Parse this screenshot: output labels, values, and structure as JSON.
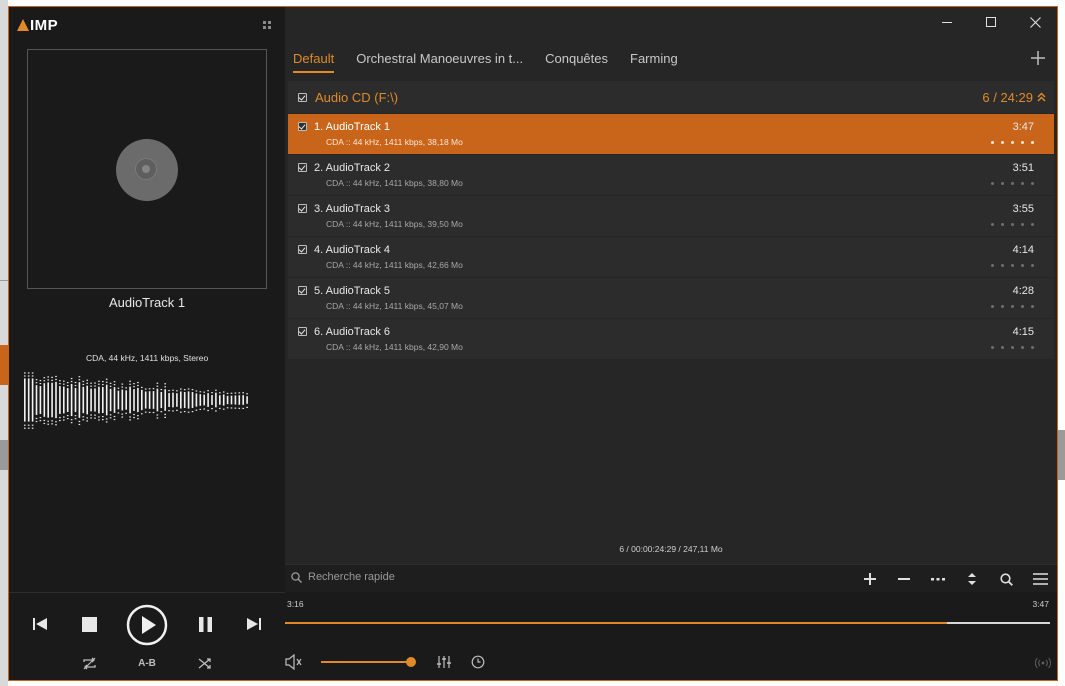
{
  "app": {
    "logo_text": "IMP"
  },
  "now_playing": {
    "title": "AudioTrack 1",
    "format_info": "CDA, 44 kHz, 1411 kbps, Stereo"
  },
  "tabs": [
    {
      "label": "Default",
      "active": true
    },
    {
      "label": "Orchestral Manoeuvres in t..."
    },
    {
      "label": "Conquêtes"
    },
    {
      "label": "Farming"
    }
  ],
  "group": {
    "title": "Audio CD (F:\\)",
    "count": "6 / 24:29"
  },
  "tracks": [
    {
      "name": "1. AudioTrack 1",
      "meta": "CDA :: 44 kHz, 1411 kbps, 38,18 Mo",
      "duration": "3:47",
      "active": true
    },
    {
      "name": "2. AudioTrack 2",
      "meta": "CDA :: 44 kHz, 1411 kbps, 38,80 Mo",
      "duration": "3:51"
    },
    {
      "name": "3. AudioTrack 3",
      "meta": "CDA :: 44 kHz, 1411 kbps, 39,50 Mo",
      "duration": "3:55"
    },
    {
      "name": "4. AudioTrack 4",
      "meta": "CDA :: 44 kHz, 1411 kbps, 42,66 Mo",
      "duration": "4:14"
    },
    {
      "name": "5. AudioTrack 5",
      "meta": "CDA :: 44 kHz, 1411 kbps, 45,07 Mo",
      "duration": "4:28"
    },
    {
      "name": "6. AudioTrack 6",
      "meta": "CDA :: 44 kHz, 1411 kbps, 42,90 Mo",
      "duration": "4:15"
    }
  ],
  "playlist_summary": "6 / 00:00:24:29 / 247,11 Mo",
  "search": {
    "placeholder": "Recherche rapide"
  },
  "playback": {
    "current_time": "3:16",
    "total_time": "3:47",
    "progress_fraction": 0.865,
    "volume_fraction": 1.0,
    "ab_label": "A-B"
  },
  "colors": {
    "accent": "#e08a2a",
    "active_row": "#c8651a",
    "background": "#1e1e1e"
  },
  "icons": [
    "aimp-logo-icon",
    "grip-icon",
    "cd-disc-icon",
    "minimize-icon",
    "maximize-icon",
    "close-icon",
    "add-tab-icon",
    "collapse-icon",
    "search-icon",
    "add-icon",
    "remove-icon",
    "more-icon",
    "sort-icon",
    "find-icon",
    "menu-icon",
    "previous-icon",
    "stop-icon",
    "play-icon",
    "pause-icon",
    "next-icon",
    "repeat-icon",
    "shuffle-icon",
    "volume-icon",
    "equalizer-icon",
    "clock-icon",
    "broadcast-icon"
  ]
}
